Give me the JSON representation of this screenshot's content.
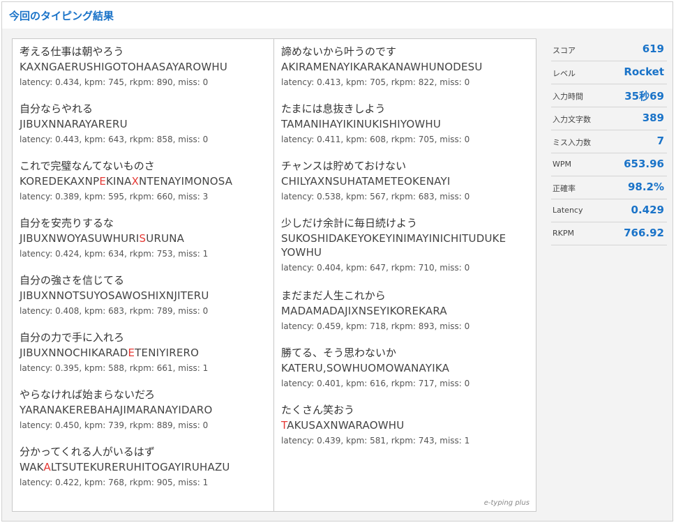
{
  "header": {
    "title": "今回のタイピング結果"
  },
  "results_left": [
    {
      "jp": "考える仕事は朝やろう",
      "segments": [
        {
          "t": "KAXNGAERUSHIGOTOHAASAYAROWHU",
          "m": false
        }
      ],
      "stats": "latency: 0.434, kpm: 745, rkpm: 890, miss: 0"
    },
    {
      "jp": "自分ならやれる",
      "segments": [
        {
          "t": "JIBUXNNARAYARERU",
          "m": false
        }
      ],
      "stats": "latency: 0.443, kpm: 643, rkpm: 858, miss: 0"
    },
    {
      "jp": "これで完璧なんてないものさ",
      "segments": [
        {
          "t": "KOREDEKAXNP",
          "m": false
        },
        {
          "t": "E",
          "m": true
        },
        {
          "t": "KINA",
          "m": false
        },
        {
          "t": "X",
          "m": true
        },
        {
          "t": "NTENAYIMONOSA",
          "m": false
        }
      ],
      "stats": "latency: 0.389, kpm: 595, rkpm: 660, miss: 3"
    },
    {
      "jp": "自分を安売りするな",
      "segments": [
        {
          "t": "JIBUXNWOYASUWHURI",
          "m": false
        },
        {
          "t": "S",
          "m": true
        },
        {
          "t": "URUNA",
          "m": false
        }
      ],
      "stats": "latency: 0.424, kpm: 634, rkpm: 753, miss: 1"
    },
    {
      "jp": "自分の強さを信じてる",
      "segments": [
        {
          "t": "JIBUXNNOTSUYOSAWOSHIXNJITERU",
          "m": false
        }
      ],
      "stats": "latency: 0.408, kpm: 683, rkpm: 789, miss: 0"
    },
    {
      "jp": "自分の力で手に入れろ",
      "segments": [
        {
          "t": "JIBUXNNOCHIKARAD",
          "m": false
        },
        {
          "t": "E",
          "m": true
        },
        {
          "t": "TENIYIRERO",
          "m": false
        }
      ],
      "stats": "latency: 0.395, kpm: 588, rkpm: 661, miss: 1"
    },
    {
      "jp": "やらなければ始まらないだろ",
      "segments": [
        {
          "t": "YARANAKEREBAHAJIMARANAYIDARO",
          "m": false
        }
      ],
      "stats": "latency: 0.450, kpm: 739, rkpm: 889, miss: 0"
    },
    {
      "jp": "分かってくれる人がいるはず",
      "segments": [
        {
          "t": "WAK",
          "m": false
        },
        {
          "t": "A",
          "m": true
        },
        {
          "t": "LTSUTEKURERUHITOGAYIRUHAZU",
          "m": false
        }
      ],
      "stats": "latency: 0.422, kpm: 768, rkpm: 905, miss: 1"
    }
  ],
  "results_right": [
    {
      "jp": "諦めないから叶うのです",
      "segments": [
        {
          "t": "AKIRAMENAYIKARAKANAWHUNODESU",
          "m": false
        }
      ],
      "stats": "latency: 0.413, kpm: 705, rkpm: 822, miss: 0"
    },
    {
      "jp": "たまには息抜きしよう",
      "segments": [
        {
          "t": "TAMANIHAYIKINUKISHIYOWHU",
          "m": false
        }
      ],
      "stats": "latency: 0.411, kpm: 608, rkpm: 705, miss: 0"
    },
    {
      "jp": "チャンスは貯めておけない",
      "segments": [
        {
          "t": "CHILYAXNSUHATAMETEOKENAYI",
          "m": false
        }
      ],
      "stats": "latency: 0.538, kpm: 567, rkpm: 683, miss: 0"
    },
    {
      "jp": "少しだけ余計に毎日続けよう",
      "segments": [
        {
          "t": "SUKOSHIDAKEYOKEYINIMAYINICHITUDUKE",
          "m": false
        }
      ],
      "line2": "YOWHU",
      "stats": "latency: 0.404, kpm: 647, rkpm: 710, miss: 0"
    },
    {
      "jp": "まだまだ人生これから",
      "segments": [
        {
          "t": "MADAMADAJIXNSEYIKOREKARA",
          "m": false
        }
      ],
      "stats": "latency: 0.459, kpm: 718, rkpm: 893, miss: 0"
    },
    {
      "jp": "勝てる、そう思わないか",
      "segments": [
        {
          "t": "KATERU,SOWHUOMOWANAYIKA",
          "m": false
        }
      ],
      "stats": "latency: 0.401, kpm: 616, rkpm: 717, miss: 0"
    },
    {
      "jp": "たくさん笑おう",
      "segments": [
        {
          "t": "T",
          "m": true
        },
        {
          "t": "AKUSAXNWARAOWHU",
          "m": false
        }
      ],
      "stats": "latency: 0.439, kpm: 581, rkpm: 743, miss: 1"
    }
  ],
  "watermark": "e-typing plus",
  "summary": [
    {
      "label": "スコア",
      "value": "619"
    },
    {
      "label": "レベル",
      "value": "Rocket"
    },
    {
      "label": "入力時間",
      "value": "35秒69"
    },
    {
      "label": "入力文字数",
      "value": "389"
    },
    {
      "label": "ミス入力数",
      "value": "7"
    },
    {
      "label": "WPM",
      "value": "653.96"
    },
    {
      "label": "正確率",
      "value": "98.2%"
    },
    {
      "label": "Latency",
      "value": "0.429"
    },
    {
      "label": "RKPM",
      "value": "766.92"
    }
  ],
  "colors": {
    "accent": "#1a73c8",
    "miss": "#e53935"
  }
}
